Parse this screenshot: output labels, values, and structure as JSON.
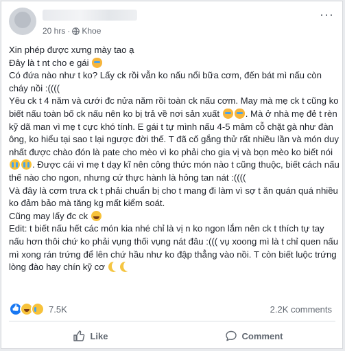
{
  "post": {
    "time": "20 hrs",
    "separator": "·",
    "group": "Khoe",
    "more_label": "···",
    "lines": [
      {
        "parts": [
          {
            "t": "Xin phép được xưng mày tao ạ"
          }
        ]
      },
      {
        "parts": [
          {
            "t": "Đây là t nt cho e gái "
          },
          {
            "e": "cat"
          }
        ]
      },
      {
        "parts": [
          {
            "t": "Có đứa nào như t ko? Lấy ck rồi vẫn ko nấu nổi bữa cơm, đến bát mì nấu còn cháy nồi :(((("
          }
        ]
      },
      {
        "parts": [
          {
            "t": "Yêu ck t 4 năm và cưới đc nửa năm rồi toàn ck nấu cơm. May mà mẹ ck t cũng ko biết nấu toàn bố ck nấu nên ko bị trả về nơi sản xuất "
          },
          {
            "e": "cat"
          },
          {
            "e": "cat"
          },
          {
            "t": ". Mà ở nhà mẹ đẻ t rèn kỹ dã man vì mẹ t cực khó tính. E gái t tự mình nấu 4-5 mâm cỗ chặt gà như đàn ông, ko hiểu tại sao t lại ngược đời thế. T đã cố gắng thử rất nhiều lần và món duy nhất được chào đón là pate cho mèo vì ko phải cho gia vị và bọn mèo ko biết nói "
          },
          {
            "e": "cry"
          },
          {
            "e": "cry"
          },
          {
            "t": ". Được cái vì mẹ t dạy kĩ nên công thức món nào t cũng thuộc, biết cách nấu thế nào cho ngon, nhưng cứ thực hành là hỏng tan nát :(((("
          }
        ]
      },
      {
        "parts": [
          {
            "t": "Và đây là cơm trưa ck t phải chuẩn bị cho t mang đi làm vì sợ t ăn quán quá nhiều ko đảm bảo mà tăng kg mất kiểm soát."
          }
        ]
      },
      {
        "parts": [
          {
            "t": "Cũng may lấy đc ck "
          },
          {
            "e": "laugh"
          }
        ]
      },
      {
        "parts": [
          {
            "t": "Edit: t biết nấu hết các món kia nhé chỉ là vị n ko ngon lắm nên ck t thích tự tay nấu hơn thôi chứ ko phải vụng thối vụng nát đâu :((( vụ xoong mì là t chỉ quen nấu mì xong rán trứng để lên chứ hầu như ko đập thẳng vào nồi. T còn biết luộc trứng lòng đào hay chín kỹ cơ "
          },
          {
            "e": "moon"
          },
          {
            "e": "moon"
          }
        ]
      }
    ]
  },
  "reactions": {
    "count": "7.5K",
    "types": [
      "like-reaction-icon",
      "haha-reaction-icon",
      "sad-reaction-icon"
    ]
  },
  "comments_count": "2.2K comments",
  "actions": {
    "like": "Like",
    "comment": "Comment"
  },
  "colors": {
    "accent": "#1877f2",
    "text": "#1d2129",
    "meta": "#616770"
  }
}
